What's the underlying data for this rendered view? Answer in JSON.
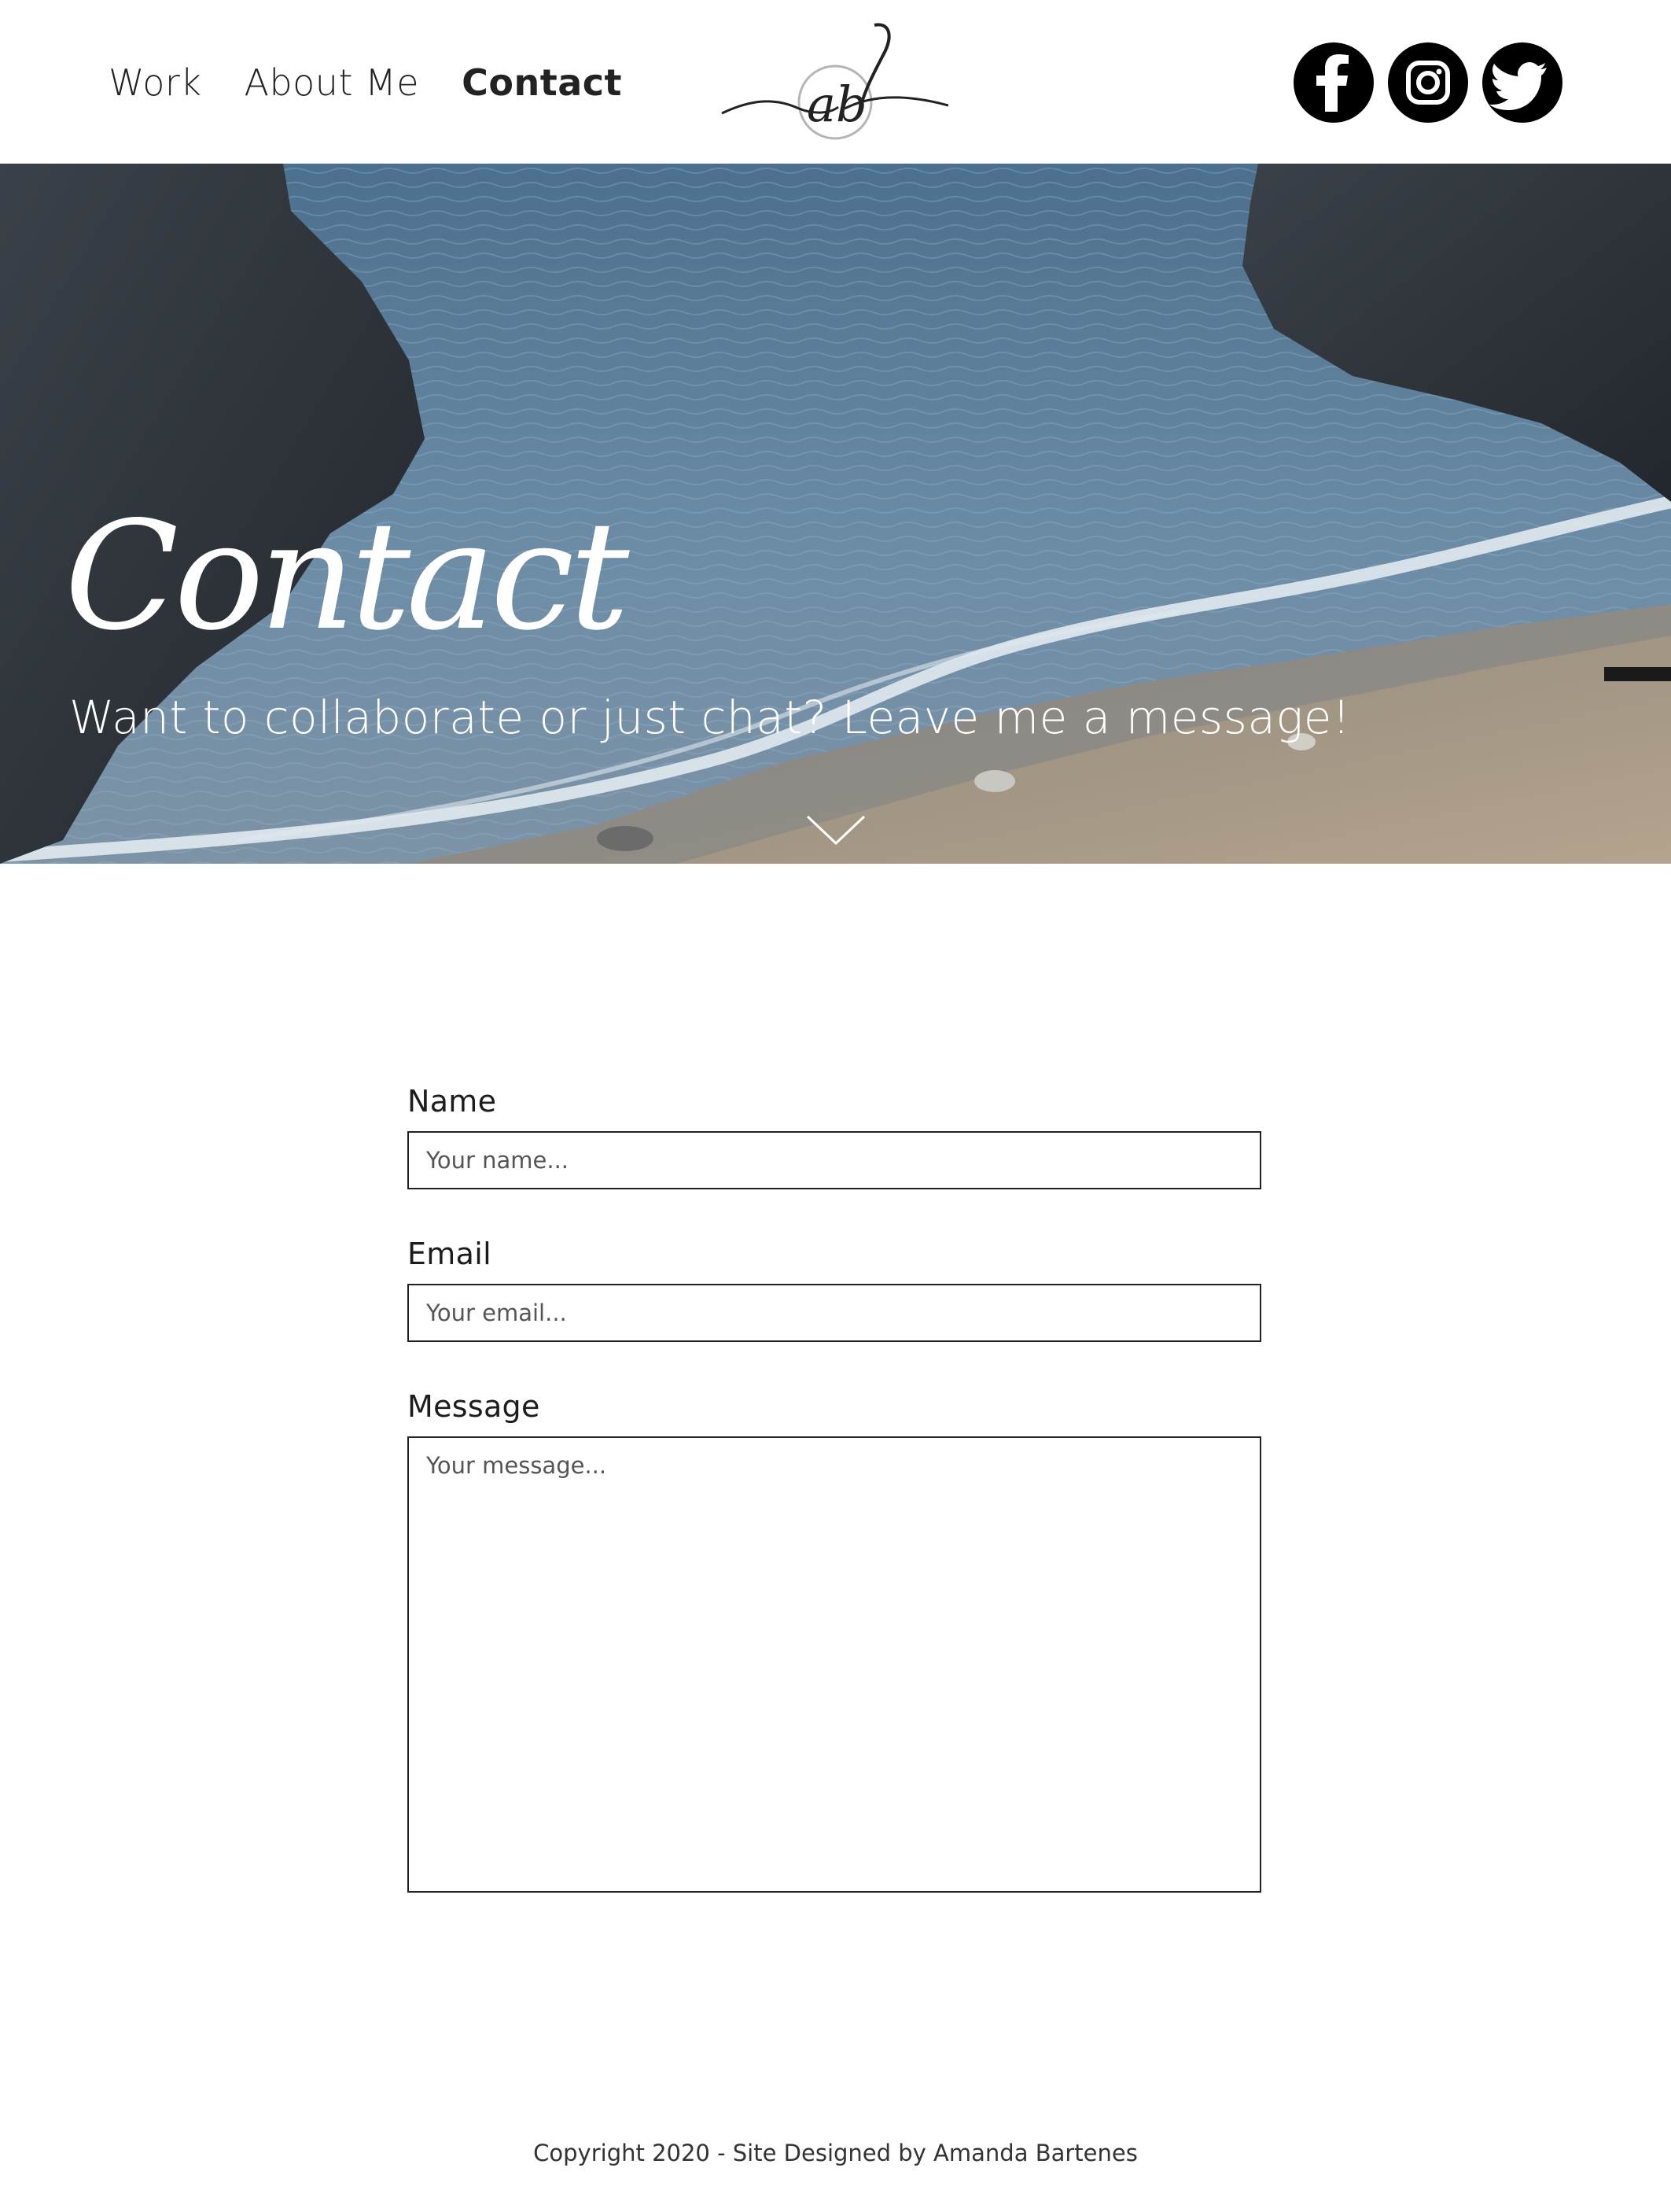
{
  "nav": {
    "items": [
      {
        "label": "Work",
        "active": false
      },
      {
        "label": "About Me",
        "active": false
      },
      {
        "label": "Contact",
        "active": true
      }
    ]
  },
  "logo": {
    "text": "ab"
  },
  "social": [
    {
      "name": "facebook-icon",
      "glyph": "f"
    },
    {
      "name": "instagram-icon"
    },
    {
      "name": "twitter-icon"
    }
  ],
  "hero": {
    "title": "Contact",
    "subtitle": "Want to collaborate or just chat? Leave me a message!"
  },
  "form": {
    "name_label": "Name",
    "name_placeholder": "Your name...",
    "email_label": "Email",
    "email_placeholder": "Your email...",
    "message_label": "Message",
    "message_placeholder": "Your message..."
  },
  "footer": {
    "text": "Copyright 2020 - Site Designed by Amanda Bartenes"
  },
  "colors": {
    "text": "#1c1c1c",
    "icon_bg": "#000000",
    "background": "#ffffff"
  }
}
